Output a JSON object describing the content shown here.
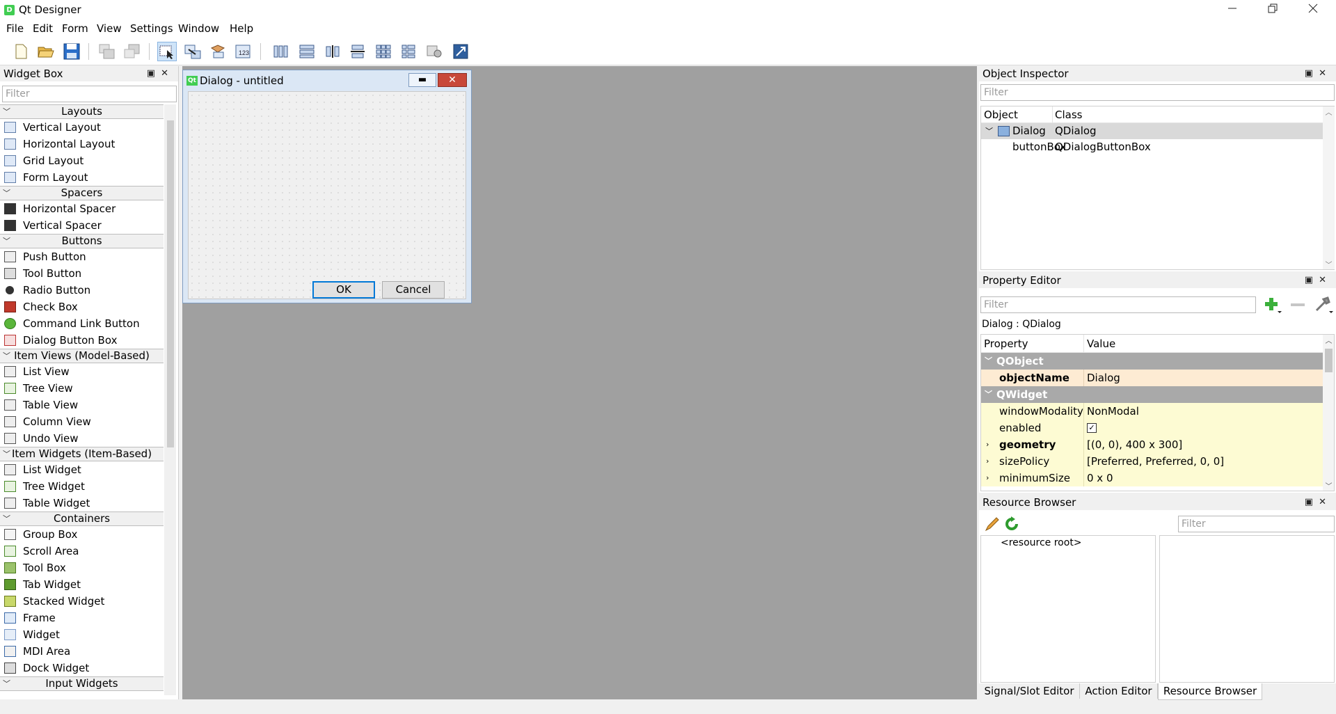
{
  "window": {
    "title": "Qt Designer",
    "icon_letter": "D"
  },
  "menu": [
    "File",
    "Edit",
    "Form",
    "View",
    "Settings",
    "Window",
    "Help"
  ],
  "widget_box": {
    "title": "Widget Box",
    "filter_placeholder": "Filter",
    "sections": [
      {
        "name": "Layouts",
        "items": [
          "Vertical Layout",
          "Horizontal Layout",
          "Grid Layout",
          "Form Layout"
        ]
      },
      {
        "name": "Spacers",
        "items": [
          "Horizontal Spacer",
          "Vertical Spacer"
        ]
      },
      {
        "name": "Buttons",
        "items": [
          "Push Button",
          "Tool Button",
          "Radio Button",
          "Check Box",
          "Command Link Button",
          "Dialog Button Box"
        ]
      },
      {
        "name": "Item Views (Model-Based)",
        "items": [
          "List View",
          "Tree View",
          "Table View",
          "Column View",
          "Undo View"
        ]
      },
      {
        "name": "Item Widgets (Item-Based)",
        "items": [
          "List Widget",
          "Tree Widget",
          "Table Widget"
        ]
      },
      {
        "name": "Containers",
        "items": [
          "Group Box",
          "Scroll Area",
          "Tool Box",
          "Tab Widget",
          "Stacked Widget",
          "Frame",
          "Widget",
          "MDI Area",
          "Dock Widget"
        ]
      },
      {
        "name": "Input Widgets",
        "items": []
      }
    ]
  },
  "dialog": {
    "title": "Dialog - untitled",
    "icon_text": "Qt",
    "ok_label": "OK",
    "cancel_label": "Cancel"
  },
  "object_inspector": {
    "title": "Object Inspector",
    "filter_placeholder": "Filter",
    "col_object": "Object",
    "col_class": "Class",
    "rows": [
      {
        "object": "Dialog",
        "class": "QDialog"
      },
      {
        "object": "buttonBox",
        "class": "QDialogButtonBox"
      }
    ]
  },
  "property_editor": {
    "title": "Property Editor",
    "filter_placeholder": "Filter",
    "context": "Dialog : QDialog",
    "col_property": "Property",
    "col_value": "Value",
    "group_qobject": "QObject",
    "group_qwidget": "QWidget",
    "props": [
      {
        "name": "objectName",
        "value": "Dialog"
      },
      {
        "name": "windowModality",
        "value": "NonModal"
      },
      {
        "name": "enabled",
        "value": ""
      },
      {
        "name": "geometry",
        "value": "[(0, 0), 400 x 300]"
      },
      {
        "name": "sizePolicy",
        "value": "[Preferred, Preferred, 0, 0]"
      },
      {
        "name": "minimumSize",
        "value": "0 x 0"
      }
    ]
  },
  "resource_browser": {
    "title": "Resource Browser",
    "filter_placeholder": "Filter",
    "root_label": "<resource root>"
  },
  "bottom_tabs": [
    "Signal/Slot Editor",
    "Action Editor",
    "Resource Browser"
  ],
  "colors": {
    "accent": "#0078d7",
    "group_bg": "#a9a9a9",
    "qobject_row": "#fdebd3",
    "qwidget_row": "#fdfbd3",
    "qt_green": "#41cd52"
  }
}
